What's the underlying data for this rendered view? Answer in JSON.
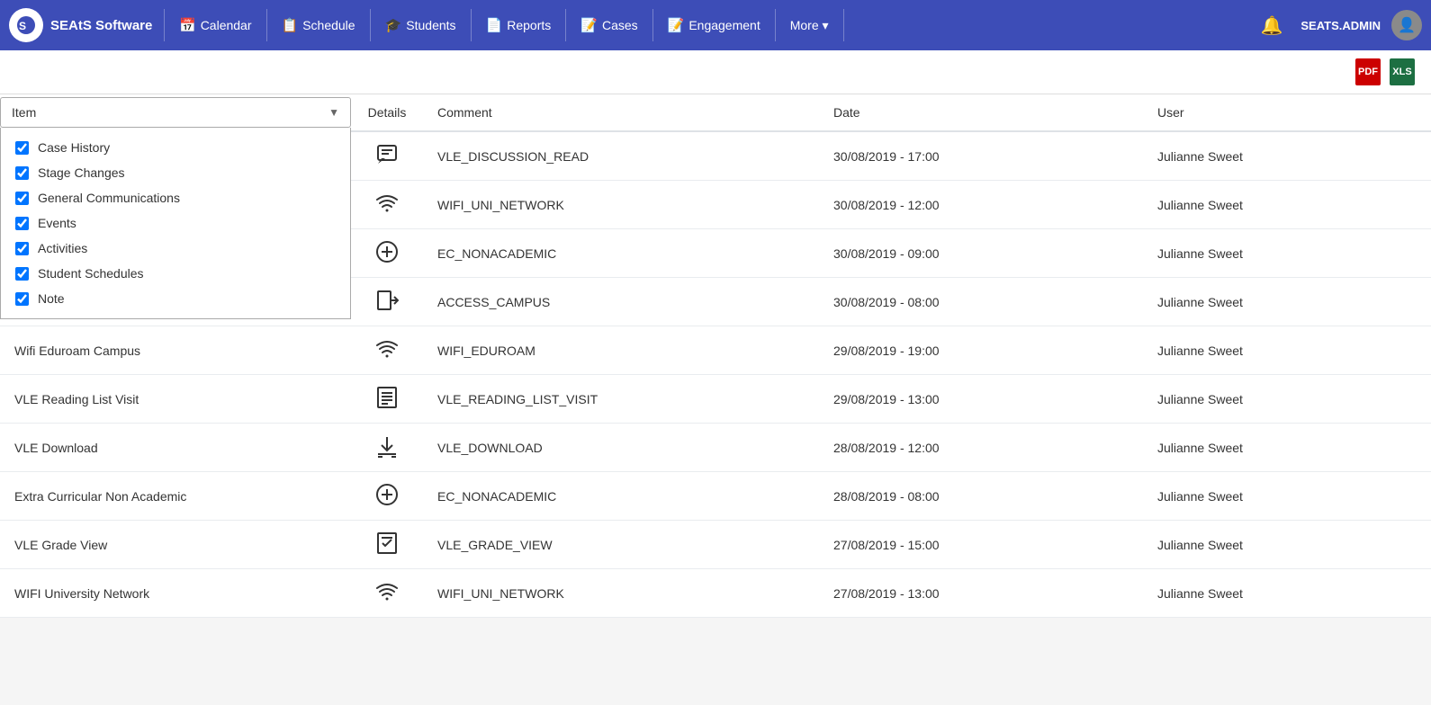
{
  "brand": {
    "name": "SEAtS Software"
  },
  "nav": {
    "items": [
      {
        "id": "calendar",
        "label": "Calendar",
        "icon": "📅"
      },
      {
        "id": "schedule",
        "label": "Schedule",
        "icon": "📋"
      },
      {
        "id": "students",
        "label": "Students",
        "icon": "🎓"
      },
      {
        "id": "reports",
        "label": "Reports",
        "icon": "📄"
      },
      {
        "id": "cases",
        "label": "Cases",
        "icon": "📝"
      },
      {
        "id": "engagement",
        "label": "Engagement",
        "icon": "📝"
      },
      {
        "id": "more",
        "label": "More ▾",
        "icon": ""
      }
    ],
    "admin_label": "SEATS.ADMIN"
  },
  "toolbar": {
    "pdf_label": "PDF",
    "excel_label": "XLS"
  },
  "filter": {
    "label": "Item",
    "options": [
      {
        "id": "case_history",
        "label": "Case History",
        "checked": true
      },
      {
        "id": "stage_changes",
        "label": "Stage Changes",
        "checked": true
      },
      {
        "id": "general_comms",
        "label": "General Communications",
        "checked": true
      },
      {
        "id": "events",
        "label": "Events",
        "checked": true
      },
      {
        "id": "activities",
        "label": "Activities",
        "checked": true
      },
      {
        "id": "student_schedules",
        "label": "Student Schedules",
        "checked": true
      },
      {
        "id": "note",
        "label": "Note",
        "checked": true
      }
    ]
  },
  "table": {
    "columns": [
      "Item",
      "Details",
      "Comment",
      "Date",
      "User"
    ],
    "rows": [
      {
        "item": "",
        "icon": "chat",
        "comment": "VLE_DISCUSSION_READ",
        "date": "30/08/2019 - 17:00",
        "user": "Julianne Sweet"
      },
      {
        "item": "",
        "icon": "wifi",
        "comment": "WIFI_UNI_NETWORK",
        "date": "30/08/2019 - 12:00",
        "user": "Julianne Sweet"
      },
      {
        "item": "",
        "icon": "circle-plus",
        "comment": "EC_NONACADEMIC",
        "date": "30/08/2019 - 09:00",
        "user": "Julianne Sweet"
      },
      {
        "item": "",
        "icon": "signin",
        "comment": "ACCESS_CAMPUS",
        "date": "30/08/2019 - 08:00",
        "user": "Julianne Sweet"
      },
      {
        "item": "Wifi Eduroam Campus",
        "icon": "wifi",
        "comment": "WIFI_EDUROAM",
        "date": "29/08/2019 - 19:00",
        "user": "Julianne Sweet"
      },
      {
        "item": "VLE Reading List Visit",
        "icon": "list",
        "comment": "VLE_READING_LIST_VISIT",
        "date": "29/08/2019 - 13:00",
        "user": "Julianne Sweet"
      },
      {
        "item": "VLE Download",
        "icon": "download",
        "comment": "VLE_DOWNLOAD",
        "date": "28/08/2019 - 12:00",
        "user": "Julianne Sweet"
      },
      {
        "item": "Extra Curricular Non Academic",
        "icon": "circle-plus",
        "comment": "EC_NONACADEMIC",
        "date": "28/08/2019 - 08:00",
        "user": "Julianne Sweet"
      },
      {
        "item": "VLE Grade View",
        "icon": "grade",
        "comment": "VLE_GRADE_VIEW",
        "date": "27/08/2019 - 15:00",
        "user": "Julianne Sweet"
      },
      {
        "item": "WIFI University Network",
        "icon": "wifi",
        "comment": "WIFI_UNI_NETWORK",
        "date": "27/08/2019 - 13:00",
        "user": "Julianne Sweet"
      }
    ]
  }
}
